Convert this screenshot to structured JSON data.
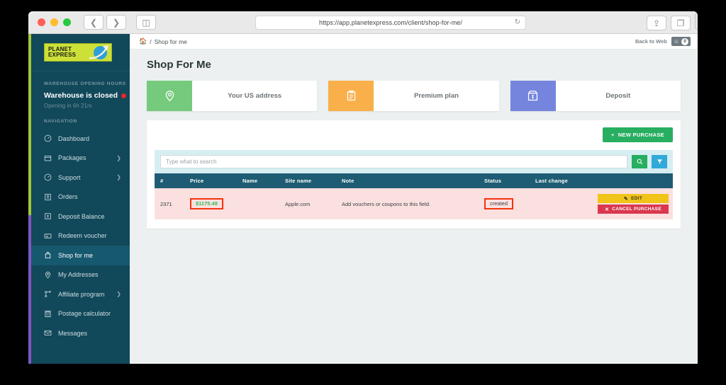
{
  "browser": {
    "url": "https://app.planetexpress.com/client/shop-for-me/",
    "back_icon": "chevron-left-icon",
    "forward_icon": "chevron-right-icon",
    "sidebar_toggle_icon": "sidebar-panel-icon",
    "reload_icon": "reload-icon",
    "share_icon": "share-icon",
    "tabs_icon": "tabs-overview-icon",
    "new_tab_label": "+"
  },
  "sidebar": {
    "logo_line1": "PLANET",
    "logo_line2": "EXPRESS",
    "warehouse_heading": "WAREHOUSE OPENING HOURS",
    "warehouse_status": "Warehouse is closed",
    "warehouse_sub": "Opening in 6h 21m",
    "nav_heading": "NAVIGATION",
    "items": [
      {
        "label": "Dashboard",
        "icon": "dashboard-icon",
        "chevron": false,
        "active": false
      },
      {
        "label": "Packages",
        "icon": "package-box-icon",
        "chevron": true,
        "active": false
      },
      {
        "label": "Support",
        "icon": "support-icon",
        "chevron": true,
        "active": false
      },
      {
        "label": "Orders",
        "icon": "orders-list-icon",
        "chevron": false,
        "active": false
      },
      {
        "label": "Deposit Balance",
        "icon": "deposit-balance-icon",
        "chevron": false,
        "active": false
      },
      {
        "label": "Redeem voucher",
        "icon": "voucher-icon",
        "chevron": false,
        "active": false
      },
      {
        "label": "Shop for me",
        "icon": "shopping-bag-icon",
        "chevron": false,
        "active": true
      },
      {
        "label": "My Addresses",
        "icon": "map-pin-icon",
        "chevron": false,
        "active": false
      },
      {
        "label": "Affiliate program",
        "icon": "affiliate-network-icon",
        "chevron": true,
        "active": false
      },
      {
        "label": "Postage calculator",
        "icon": "calculator-icon",
        "chevron": false,
        "active": false
      },
      {
        "label": "Messages",
        "icon": "envelope-icon",
        "chevron": false,
        "active": false
      }
    ]
  },
  "topbar": {
    "home_icon": "home-icon",
    "breadcrumb_sep": "/",
    "breadcrumb_current": "Shop for me",
    "back_to_web": "Back to Web",
    "message_icon": "message-bubble-icon",
    "message_count": "0"
  },
  "main": {
    "page_title": "Shop For Me",
    "cards": [
      {
        "label": "Your US address",
        "icon": "map-pin-icon",
        "color": "#76ca7d",
        "tone": "green"
      },
      {
        "label": "Premium plan",
        "icon": "clipboard-icon",
        "color": "#f9b04a",
        "tone": "orange"
      },
      {
        "label": "Deposit",
        "icon": "money-box-icon",
        "color": "#7585de",
        "tone": "blue"
      }
    ],
    "new_purchase_label": "NEW PURCHASE",
    "new_purchase_icon": "plus-icon",
    "search": {
      "placeholder": "Type what to search",
      "value": "",
      "search_icon": "search-icon",
      "filter_icon": "filter-funnel-icon"
    },
    "table": {
      "columns": [
        "#",
        "Price",
        "Name",
        "Site name",
        "Note",
        "Status",
        "Last change",
        ""
      ],
      "rows": [
        {
          "id": "2371",
          "price": "$1175.48",
          "name": "",
          "site_name": "Apple.com",
          "note": "Add vouchers or coupons to this field.",
          "status": "created",
          "last_change": "",
          "edit_label": "EDIT",
          "edit_icon": "pencil-icon",
          "cancel_label": "CANCEL PURCHASE",
          "cancel_icon": "x-icon"
        }
      ]
    }
  },
  "annotations": {
    "highlight_color": "#f4330e",
    "price_color": "#2fbf57"
  }
}
